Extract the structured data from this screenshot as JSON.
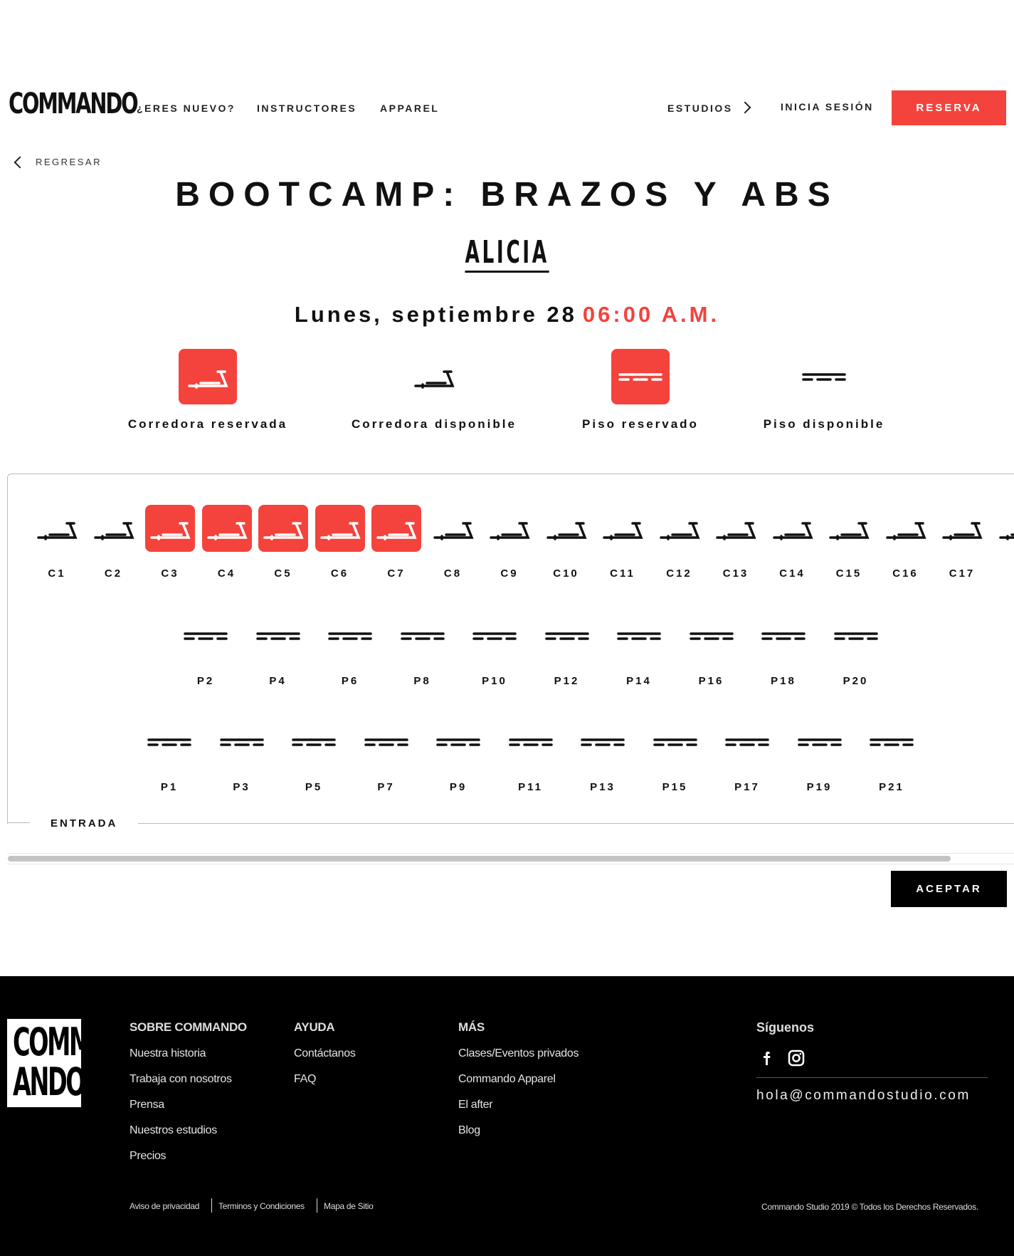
{
  "header": {
    "logo": "COMMANDO",
    "nav": [
      "¿ERES NUEVO?",
      "INSTRUCTORES",
      "APPAREL"
    ],
    "studios_label": "ESTUDIOS",
    "login_label": "INICIA SESIÓN",
    "reserve_label": "RESERVA"
  },
  "back_label": "REGRESAR",
  "class_info": {
    "title": "BOOTCAMP: BRAZOS Y ABS",
    "instructor": "ALICIA",
    "date": "Lunes, septiembre 28",
    "time": "06:00 A.M."
  },
  "legend": [
    {
      "label": "Corredora reservada",
      "icon": "treadmill-icon",
      "reserved": true
    },
    {
      "label": "Corredora disponible",
      "icon": "treadmill-icon",
      "reserved": false
    },
    {
      "label": "Piso reservado",
      "icon": "floor-mat-icon",
      "reserved": true
    },
    {
      "label": "Piso disponible",
      "icon": "floor-mat-icon",
      "reserved": false
    }
  ],
  "seat_map": {
    "treadmills": [
      {
        "id": "C1",
        "reserved": false
      },
      {
        "id": "C2",
        "reserved": false
      },
      {
        "id": "C3",
        "reserved": true
      },
      {
        "id": "C4",
        "reserved": true
      },
      {
        "id": "C5",
        "reserved": true
      },
      {
        "id": "C6",
        "reserved": true
      },
      {
        "id": "C7",
        "reserved": true
      },
      {
        "id": "C8",
        "reserved": false
      },
      {
        "id": "C9",
        "reserved": false
      },
      {
        "id": "C10",
        "reserved": false
      },
      {
        "id": "C11",
        "reserved": false
      },
      {
        "id": "C12",
        "reserved": false
      },
      {
        "id": "C13",
        "reserved": false
      },
      {
        "id": "C14",
        "reserved": false
      },
      {
        "id": "C15",
        "reserved": false
      },
      {
        "id": "C16",
        "reserved": false
      },
      {
        "id": "C17",
        "reserved": false
      },
      {
        "id": "C",
        "reserved": false
      }
    ],
    "floor_row_1": [
      "P2",
      "P4",
      "P6",
      "P8",
      "P10",
      "P12",
      "P14",
      "P16",
      "P18",
      "P20"
    ],
    "floor_row_2": [
      "P1",
      "P3",
      "P5",
      "P7",
      "P9",
      "P11",
      "P13",
      "P15",
      "P17",
      "P19",
      "P21"
    ],
    "entrance_label": "ENTRADA"
  },
  "accept_label": "ACEPTAR",
  "footer": {
    "logo_line1": "COMM",
    "logo_line2": "ANDO",
    "columns": [
      {
        "title": "SOBRE COMMANDO",
        "links": [
          "Nuestra historia",
          "Trabaja con nosotros",
          "Prensa",
          "Nuestros estudios",
          "Precios"
        ]
      },
      {
        "title": "AYUDA",
        "links": [
          "Contáctanos",
          "FAQ"
        ]
      },
      {
        "title": "MÁS",
        "links": [
          "Clases/Eventos privados",
          "Commando Apparel",
          "El after",
          "Blog"
        ]
      }
    ],
    "social_title": "Síguenos",
    "social_icons": [
      "facebook-icon",
      "instagram-icon"
    ],
    "email": "hola@commandostudio.com",
    "legal": [
      "Aviso de privacidad",
      "Terminos y Condiciones",
      "Mapa de Sitio"
    ],
    "copyright": "Commando Studio 2019 © Todos los Derechos Reservados."
  },
  "colors": {
    "accent": "#f4433c",
    "text": "#111111",
    "footer_bg": "#000000"
  }
}
